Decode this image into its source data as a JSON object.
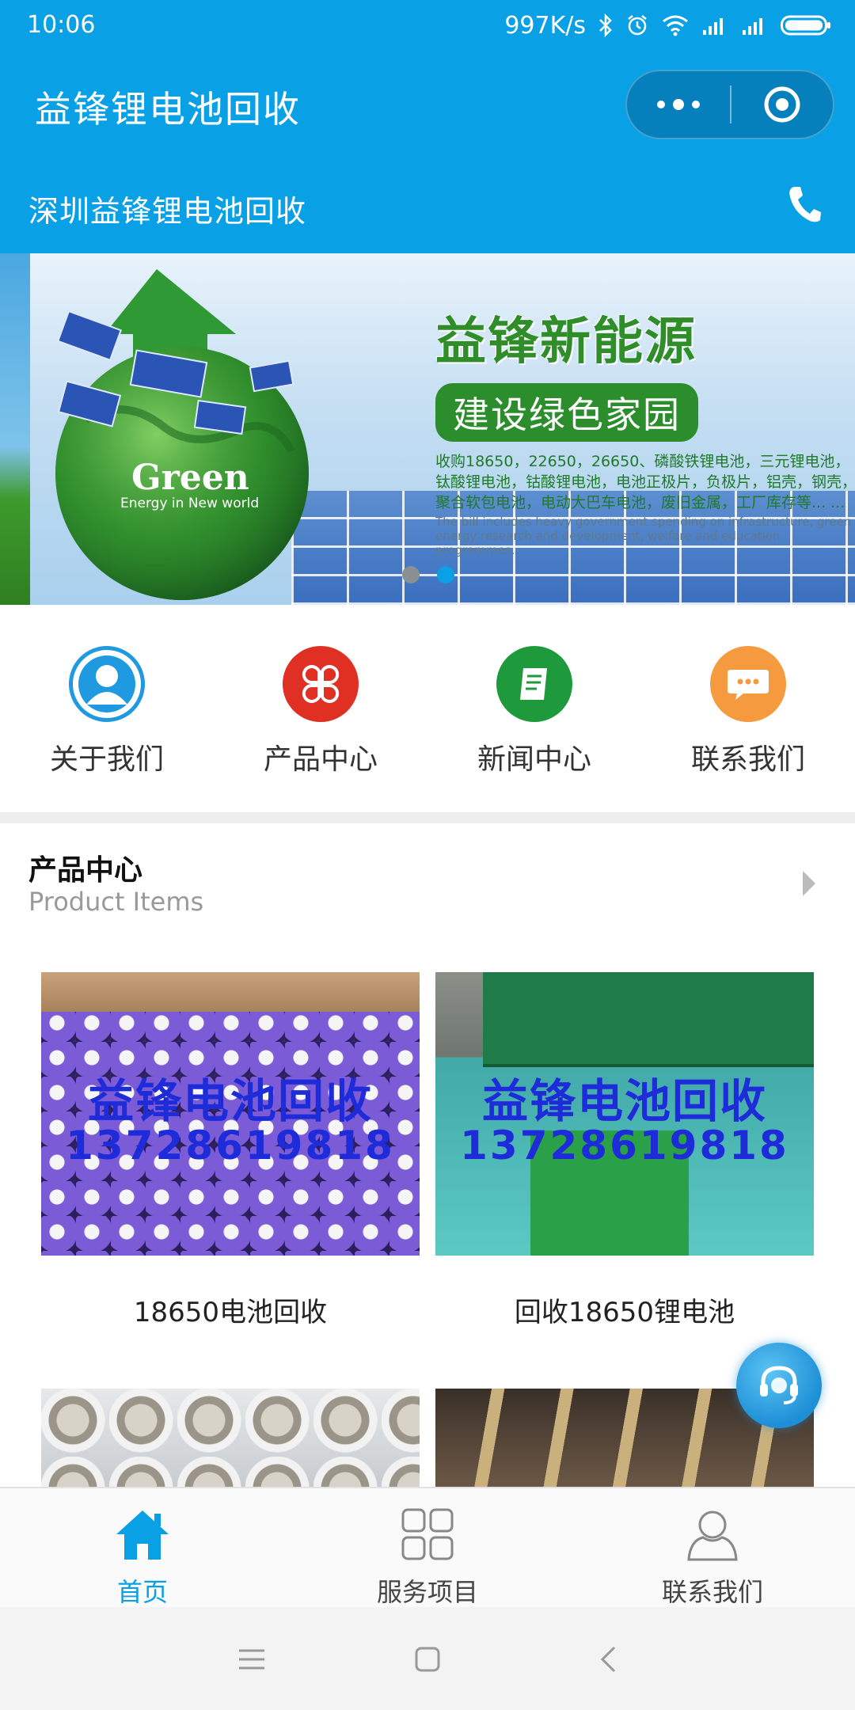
{
  "status_bar": {
    "time": "10:06",
    "speed": "997K/s",
    "icons": [
      "bluetooth-icon",
      "alarm-icon",
      "wifi-icon",
      "signal-icon",
      "signal-icon",
      "battery-icon"
    ]
  },
  "title_bar": {
    "title": "益锋锂电池回收",
    "menu_icon": "more-dots-icon",
    "close_icon": "target-close-icon"
  },
  "sub_header": {
    "title": "深圳益锋锂电池回收",
    "phone_icon": "phone-icon"
  },
  "banner": {
    "headline": "益锋新能源",
    "slogan": "建设绿色家园",
    "desc": "收购18650，22650，26650、磷酸铁锂电池，三元锂电池，钛酸锂电池，钴酸锂电池，电池正极片，负极片，铝壳，钢壳，聚合软包电池，电动大巴车电池，废旧金属，工厂库存等... ...",
    "desc_en": "The bill includes heavy government spending on infrastructure, green energy research and development, welfare and education programmes.",
    "logo_word": "Green",
    "logo_sub": "Energy in New world",
    "slide_count": 2,
    "active_slide": 2
  },
  "quick_nav": [
    {
      "label": "关于我们",
      "icon": "person-icon",
      "color": "#1f9ae0"
    },
    {
      "label": "产品中心",
      "icon": "clover-grid-icon",
      "color": "#e02f23"
    },
    {
      "label": "新闻中心",
      "icon": "news-document-icon",
      "color": "#1e9a3c"
    },
    {
      "label": "联系我们",
      "icon": "chat-bubble-icon",
      "color": "#f59a3e"
    }
  ],
  "products": {
    "title": "产品中心",
    "subtitle": "Product Items",
    "more_icon": "chevron-right-icon",
    "items": [
      {
        "name": "18650电池回收",
        "watermark_1": "益锋电池回收",
        "watermark_2": "13728619818"
      },
      {
        "name": "回收18650锂电池",
        "watermark_1": "益锋电池回收",
        "watermark_2": "13728619818"
      },
      {
        "name": ""
      },
      {
        "name": ""
      }
    ]
  },
  "float_button": {
    "icon": "customer-service-headset-icon"
  },
  "tab_bar": {
    "tabs": [
      {
        "label": "首页",
        "icon": "home-icon",
        "active": true
      },
      {
        "label": "服务项目",
        "icon": "grid-icon",
        "active": false
      },
      {
        "label": "联系我们",
        "icon": "user-icon",
        "active": false
      }
    ]
  },
  "system_nav": {
    "icons": [
      "menu-icon",
      "home-square-icon",
      "back-icon"
    ]
  },
  "colors": {
    "primary": "#0aa0e6",
    "tab_active": "#0aa0e6",
    "divider": "#eeeeee"
  }
}
